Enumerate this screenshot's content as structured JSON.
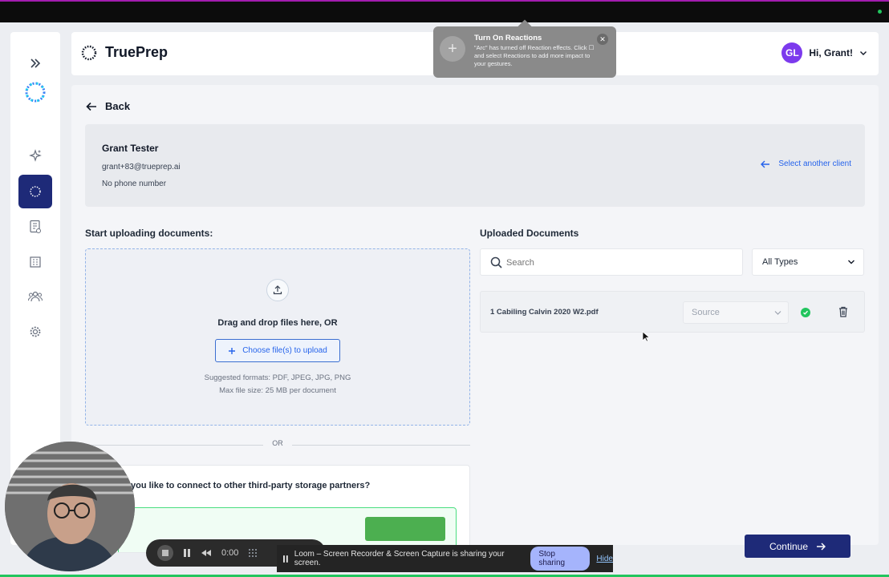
{
  "app": {
    "brand": "TruePrep"
  },
  "user": {
    "initials": "GL",
    "greeting": "Hi, Grant!"
  },
  "sidebar": {
    "items": [
      {
        "name": "expand",
        "icon": "double-chevron-right-icon"
      },
      {
        "name": "logo",
        "icon": "dotted-ring-logo"
      },
      {
        "name": "ai",
        "icon": "sparkles-icon"
      },
      {
        "name": "clients",
        "icon": "dotted-circle-icon",
        "active": true
      },
      {
        "name": "documents",
        "icon": "document-icon"
      },
      {
        "name": "organization",
        "icon": "building-icon"
      },
      {
        "name": "team",
        "icon": "people-icon"
      },
      {
        "name": "settings",
        "icon": "gear-icon"
      }
    ]
  },
  "nav": {
    "back_label": "Back"
  },
  "client": {
    "name": "Grant Tester",
    "email": "grant+83@trueprep.ai",
    "phone": "No phone number",
    "select_another": "Select another client"
  },
  "upload": {
    "title": "Start uploading documents:",
    "drag_text": "Drag and drop files here, OR",
    "choose_label": "Choose file(s) to upload",
    "formats": "Suggested formats: PDF, JPEG, JPG, PNG",
    "max_size": "Max file size: 25 MB per document",
    "or": "OR",
    "third_party": "you like to connect to other third-party storage partners?"
  },
  "uploaded": {
    "title": "Uploaded Documents",
    "search_placeholder": "Search",
    "type_filter": "All Types",
    "documents": [
      {
        "name": "1 Cabiling Calvin 2020 W2.pdf",
        "source_placeholder": "Source",
        "status": "uploaded"
      }
    ]
  },
  "footer": {
    "continue_label": "Continue"
  },
  "notification": {
    "title": "Turn On Reactions",
    "body": "\"Arc\" has turned off Reaction effects. Click ☐ and select Reactions to add more impact to your gestures."
  },
  "loom": {
    "timer": "0:00",
    "sharing_text": "Loom – Screen Recorder & Screen Capture is sharing your screen.",
    "stop_label": "Stop sharing",
    "hide_label": "Hide"
  },
  "colors": {
    "primary": "#1e2a78",
    "link": "#2563eb",
    "success": "#22c55e",
    "avatar": "#7c3aed"
  }
}
